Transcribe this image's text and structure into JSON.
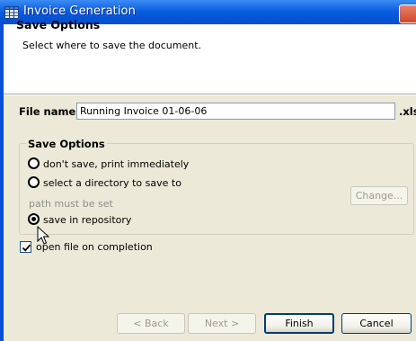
{
  "window": {
    "title": "Invoice Generation",
    "app_icon": "table-grid-icon"
  },
  "header": {
    "title": "Save Options",
    "description": "Select where to save the document."
  },
  "file": {
    "label": "File name:",
    "value": "Running Invoice 01-06-06",
    "extension": ".xls"
  },
  "save_options": {
    "title": "Save Options",
    "options": [
      {
        "label": "don't save, print immediately",
        "selected": false
      },
      {
        "label": "select a directory to save to",
        "selected": false
      },
      {
        "label": "save in repository",
        "selected": true
      }
    ],
    "hint": "path must be set",
    "change_label": "Change..."
  },
  "open_on_completion": {
    "label": "open file on completion",
    "checked": true
  },
  "buttons": {
    "back": "< Back",
    "next": "Next >",
    "finish": "Finish",
    "cancel": "Cancel"
  },
  "colors": {
    "title_bar": "#0a5fdf",
    "dialog_bg": "#ece9d8"
  }
}
